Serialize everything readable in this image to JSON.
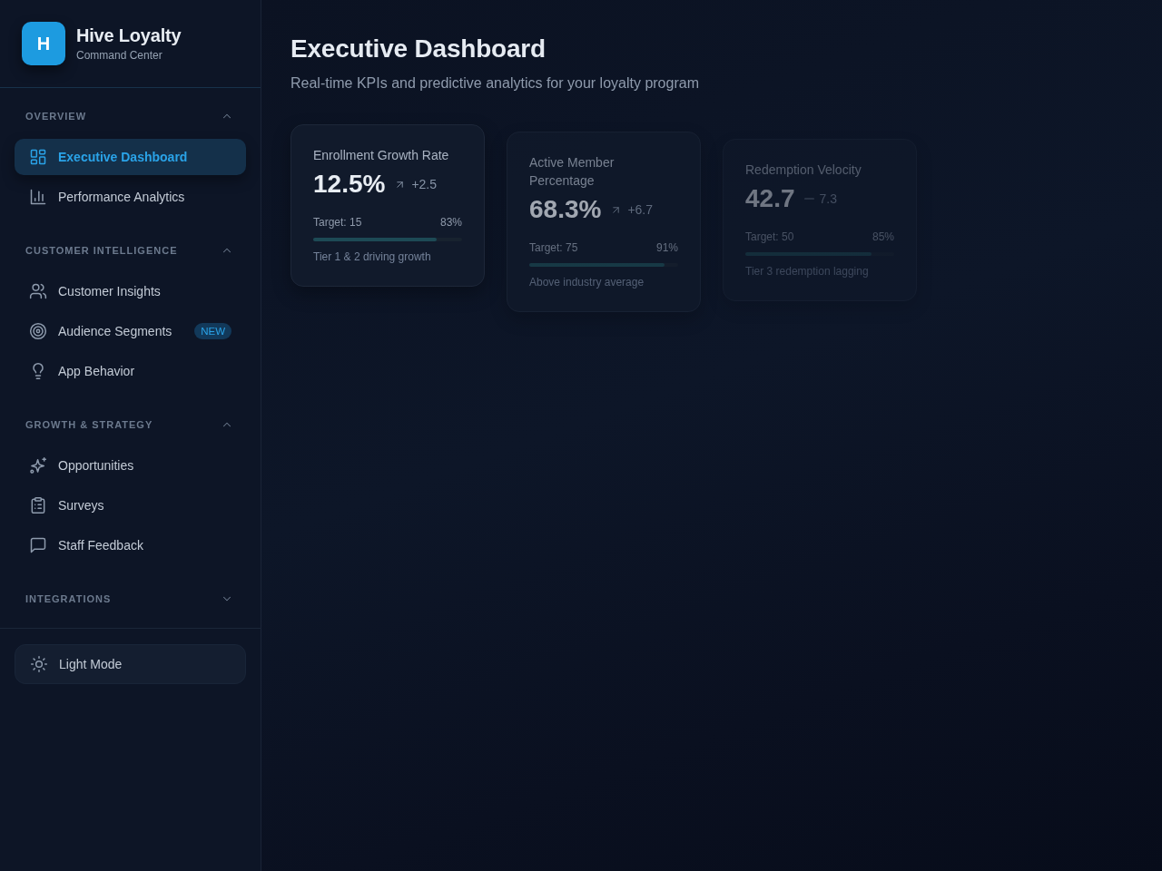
{
  "sidebar": {
    "logo": {
      "letter": "H"
    },
    "brand": {
      "name": "Hive Loyalty",
      "tagline": "Command Center"
    },
    "sections": [
      {
        "title": "OVERVIEW",
        "expanded": true,
        "items": [
          {
            "label": "Executive Dashboard",
            "selected": true
          },
          {
            "label": "Performance Analytics",
            "selected": false
          }
        ]
      },
      {
        "title": "CUSTOMER INTELLIGENCE",
        "expanded": true,
        "items": [
          {
            "label": "Customer Insights",
            "selected": false
          },
          {
            "label": "Audience Segments",
            "selected": false,
            "badge": "NEW"
          },
          {
            "label": "App Behavior",
            "selected": false
          }
        ]
      },
      {
        "title": "GROWTH & STRATEGY",
        "expanded": true,
        "items": [
          {
            "label": "Opportunities",
            "selected": false
          },
          {
            "label": "Surveys",
            "selected": false
          },
          {
            "label": "Staff Feedback",
            "selected": false
          }
        ]
      },
      {
        "title": "INTEGRATIONS",
        "expanded": false
      }
    ],
    "theme_toggle": {
      "label": "Light Mode"
    }
  },
  "main": {
    "title": "Executive Dashboard",
    "subtitle": "Real-time KPIs and predictive analytics for your loyalty program",
    "kpi_cards": [
      {
        "kind": "shown",
        "title": "Enrollment Growth Rate",
        "value": "12.5%",
        "trending_up": true,
        "delta": "+2.5",
        "target": "Target: 15",
        "percent": "83%",
        "level": 0.83,
        "note": "Tier 1 & 2 driving growth"
      },
      {
        "kind": "fading",
        "title": "Active Member Percentage",
        "value": "68.3%",
        "trending_up": true,
        "delta": "+6.7",
        "target": "Target: 75",
        "percent": "91%",
        "level": 0.91,
        "note": "Above industry average"
      },
      {
        "kind": "faint",
        "title": "Redemption Velocity",
        "value": "42.7",
        "trending_up": false,
        "delta": "7.3",
        "target": "Target: 50",
        "percent": "85%",
        "level": 0.85,
        "note": "Tier 3 redemption lagging"
      }
    ]
  }
}
